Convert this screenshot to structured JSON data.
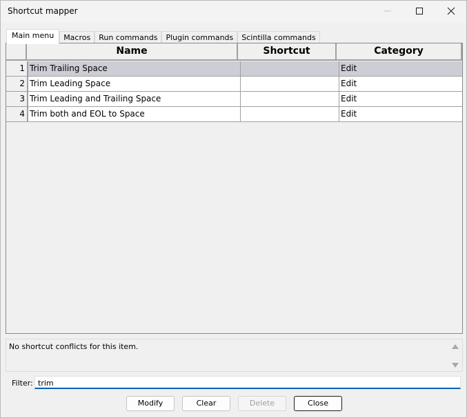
{
  "window": {
    "title": "Shortcut mapper"
  },
  "tabs": [
    {
      "label": "Main menu"
    },
    {
      "label": "Macros"
    },
    {
      "label": "Run commands"
    },
    {
      "label": "Plugin commands"
    },
    {
      "label": "Scintilla commands"
    }
  ],
  "grid": {
    "headers": {
      "name": "Name",
      "shortcut": "Shortcut",
      "category": "Category"
    },
    "rows": [
      {
        "index": "1",
        "name": "Trim Trailing Space",
        "shortcut": "",
        "category": "Edit"
      },
      {
        "index": "2",
        "name": "Trim Leading Space",
        "shortcut": "",
        "category": "Edit"
      },
      {
        "index": "3",
        "name": "Trim Leading and Trailing Space",
        "shortcut": "",
        "category": "Edit"
      },
      {
        "index": "4",
        "name": "Trim both and EOL to Space",
        "shortcut": "",
        "category": "Edit"
      }
    ]
  },
  "conflicts": {
    "text": "No shortcut conflicts for this item."
  },
  "filter": {
    "label": "Filter:",
    "value": "trim"
  },
  "buttons": {
    "modify": "Modify",
    "clear": "Clear",
    "delete": "Delete",
    "close": "Close"
  },
  "colors": {
    "selected_row": "#cdcdd5",
    "accent": "#005fb8"
  }
}
